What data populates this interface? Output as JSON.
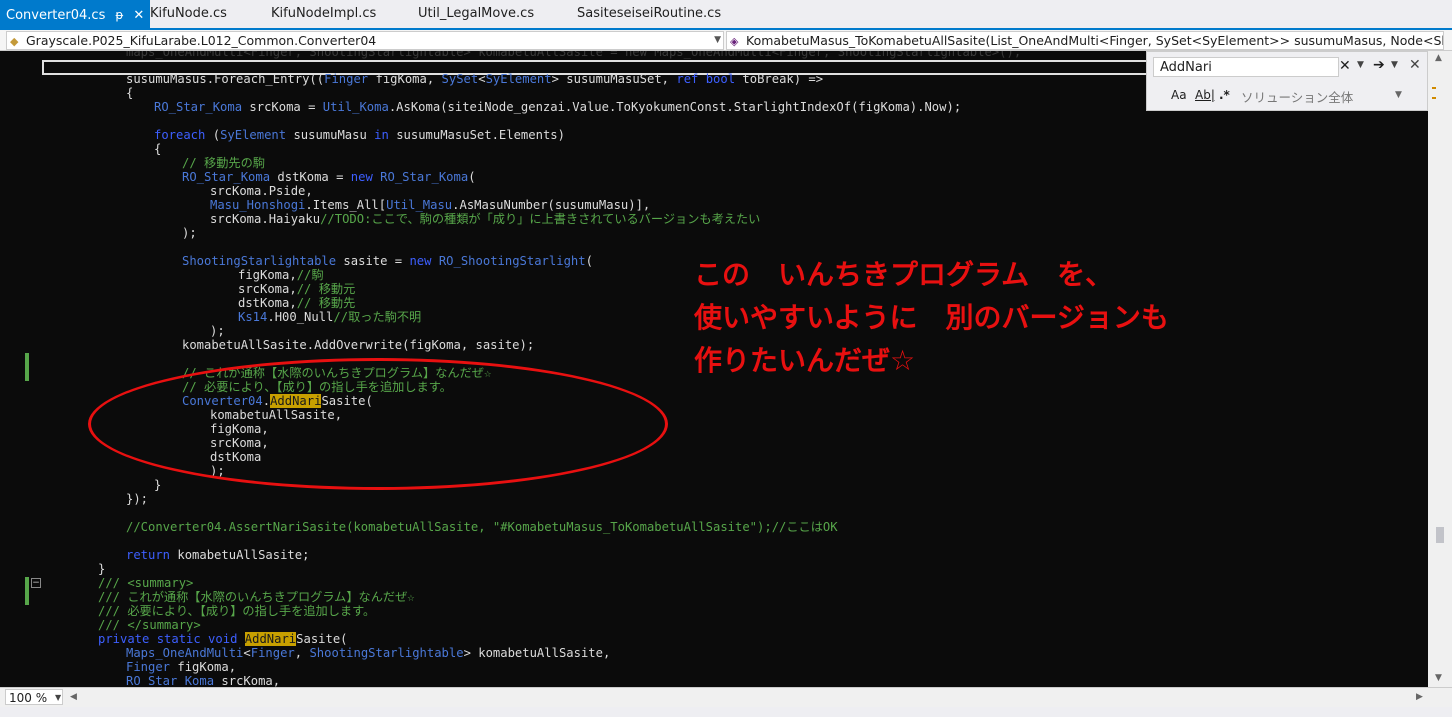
{
  "tabs": [
    {
      "label": "Converter04.cs",
      "active": true
    },
    {
      "label": "KifuNode.cs",
      "active": false
    },
    {
      "label": "KifuNodeImpl.cs",
      "active": false
    },
    {
      "label": "Util_LegalMove.cs",
      "active": false
    },
    {
      "label": "SasiteseiseiRoutine.cs",
      "active": false
    }
  ],
  "tab_icons": {
    "pin": "pin-icon",
    "close": "close-icon"
  },
  "navbar": {
    "project": "Grayscale.P025_KifuLarabe.L012_Common.Converter04",
    "member": "KomabetuMasus_ToKomabetuAllSasite(List_OneAndMulti<Finger, SySet<SyElement>> susumuMasus, Node<Shoot"
  },
  "find": {
    "value": "AddNari",
    "scope": "ソリューション全体",
    "opt_case": "Aa",
    "opt_word": "Ab|",
    "opt_regex": ".*"
  },
  "code": {
    "l00": "maps_OneAndMulti<Finger, ShootingStarlightable> komabetuAllSasite = new Maps_OneAndMulti<Finger, ShootingStarlightable>();",
    "l02a": "susumuMasus.Foreach_Entry((",
    "l02b": "Finger",
    "l02c": " figKoma, ",
    "l02d": "SySet",
    "l02e": "<",
    "l02f": "SyElement",
    "l02g": "> susumuMasuSet, ",
    "l02h": "ref bool",
    "l02i": " toBreak) =>",
    "l03": "{",
    "l04a": "RO_Star_Koma",
    "l04b": " srcKoma = ",
    "l04c": "Util_Koma",
    "l04d": ".AsKoma(siteiNode_genzai.Value.ToKyokumenConst.StarlightIndexOf(figKoma).Now);",
    "l06a": "foreach",
    "l06b": " (",
    "l06c": "SyElement",
    "l06d": " susumuMasu ",
    "l06e": "in",
    "l06f": " susumuMasuSet.Elements)",
    "l07": "{",
    "l08": "// 移動先の駒",
    "l09a": "RO_Star_Koma",
    "l09b": " dstKoma = ",
    "l09c": "new",
    "l09d": " ",
    "l09e": "RO_Star_Koma",
    "l09f": "(",
    "l10": "srcKoma.Pside,",
    "l11a": "Masu_Honshogi",
    "l11b": ".Items_All[",
    "l11c": "Util_Masu",
    "l11d": ".AsMasuNumber(susumuMasu)],",
    "l12a": "srcKoma.Haiyaku",
    "l12b": "//TODO:ここで、駒の種類が「成り」に上書きされているバージョンも考えたい",
    "l13": ");",
    "l15a": "ShootingStarlightable",
    "l15b": " sasite = ",
    "l15c": "new",
    "l15d": " ",
    "l15e": "RO_ShootingStarlight",
    "l15f": "(",
    "l16a": "figKoma,",
    "l16b": "//駒",
    "l17a": "srcKoma,",
    "l17b": "// 移動元",
    "l18a": "dstKoma,",
    "l18b": "// 移動先",
    "l19a": "Ks14",
    "l19b": ".H00_Null",
    "l19c": "//取った駒不明",
    "l20": ");",
    "l21": "komabetuAllSasite.AddOverwrite(figKoma, sasite);",
    "l23": "// これが通称【水際のいんちきプログラム】なんだぜ☆",
    "l24": "// 必要により、【成り】の指し手を追加します。",
    "l25a": "Converter04",
    "l25b": ".",
    "l25c": "AddNari",
    "l25d": "Sasite(",
    "l26": "komabetuAllSasite,",
    "l27": "figKoma,",
    "l28": "srcKoma,",
    "l29": "dstKoma",
    "l30": ");",
    "l31": "}",
    "l32": "});",
    "l34": "//Converter04.AssertNariSasite(komabetuAllSasite, \"#KomabetuMasus_ToKomabetuAllSasite\");//ここはOK",
    "l36a": "return",
    "l36b": " komabetuAllSasite;",
    "l37": "}",
    "l38": "/// <summary>",
    "l39": "/// これが通称【水際のいんちきプログラム】なんだぜ☆",
    "l40": "/// 必要により、【成り】の指し手を追加します。",
    "l41": "/// </summary>",
    "l42a": "private static void",
    "l42b": " ",
    "l42c": "AddNari",
    "l42d": "Sasite(",
    "l43a": "Maps_OneAndMulti",
    "l43b": "<",
    "l43c": "Finger",
    "l43d": ", ",
    "l43e": "ShootingStarlightable",
    "l43f": "> komabetuAllSasite,",
    "l44a": "Finger",
    "l44b": " figKoma,",
    "l45a": "RO_Star_Koma",
    "l45b": " srcKoma,"
  },
  "annotation": {
    "line1": "この　いんちきプログラム　を、",
    "line2": "使いやすいように　別のバージョンも",
    "line3": "作りたいんだぜ☆"
  },
  "status": {
    "zoom": "100 %"
  },
  "colors": {
    "accent": "#007acc",
    "annotation_red": "#e81010",
    "highlight": "#c8a000",
    "comment": "#57a64a",
    "keyword": "#3d5fff"
  }
}
